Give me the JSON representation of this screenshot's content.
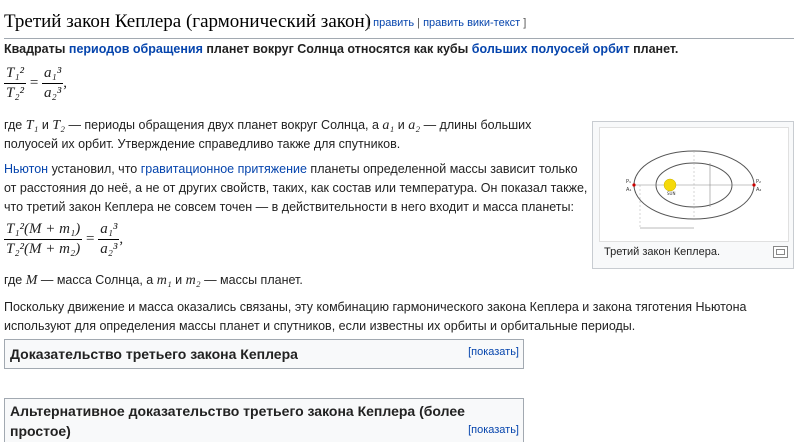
{
  "heading": {
    "title": "Третий закон Кеплера (гармонический закон)",
    "edit_open": "[ ",
    "edit_label": "править",
    "edit_sep": " | ",
    "edit_source_label": "править вики-текст",
    "edit_close": " ]"
  },
  "intro": {
    "t1": "Квадраты ",
    "link1": "периодов обращения",
    "t2": " планет вокруг Солнца относятся как кубы ",
    "link2": "больших полуосей орбит",
    "t3": " планет."
  },
  "formula1": {
    "num_left": "T₁²",
    "den_left": "T₂²",
    "eq": "=",
    "num_right": "a₁³",
    "den_right": "a₂³",
    "tail": ","
  },
  "para2": {
    "line1_a": "где ",
    "T1": "T₁",
    "line1_b": " и ",
    "T2": "T₂",
    "line1_c": " — периоды обращения двух планет вокруг Солнца, а ",
    "a1": "a₁",
    "line1_d": " и ",
    "a2": "a₂",
    "line1_e": " — длины больших",
    "line2": "полуосей их орбит. Утверждение справедливо также для спутников."
  },
  "para3": {
    "link_newton": "Ньютон",
    "line1_a": " установил, что ",
    "link_gravity": "гравитационное притяжение",
    "line1_b": " планеты определенной массы зависит только",
    "line2": "от расстояния до неё, а не от других свойств, таких, как состав или температура. Он показал также,",
    "line3": "что третий закон Кеплера не совсем точен — в действительности в него входит и масса планеты:"
  },
  "formula2": {
    "num_left": "T₁²(M + m₁)",
    "den_left": "T₂²(M + m₂)",
    "eq": "=",
    "num_right": "a₁³",
    "den_right": "a₂³",
    "tail": ","
  },
  "para4": {
    "a": "где ",
    "M": "M",
    "b": " — масса Солнца, а ",
    "m1": "m₁",
    "c": " и ",
    "m2": "m₂",
    "d": " — массы планет."
  },
  "para5": {
    "line1": "Поскольку движение и масса оказались связаны, эту комбинацию гармонического закона Кеплера и закона тяготения Ньютона",
    "line2": "используют для определения массы планет и спутников, если известны их орбиты и орбитальные периоды."
  },
  "thumb": {
    "caption": "Третий закон Кеплера.",
    "labels": {
      "p1": "P₁",
      "p2": "P₂",
      "a1": "A₁",
      "a2": "A₂",
      "sun": "SUN"
    }
  },
  "box1": {
    "title": "Доказательство третьего закона Кеплера",
    "toggle": "[показать]"
  },
  "box2": {
    "title_line1": "Альтернативное доказательство третьего закона Кеплера (более",
    "title_line2": "простое)",
    "toggle": "[показать]"
  },
  "colors": {
    "link": "#0645ad",
    "box_bg": "#f8f9fa",
    "border": "#a2a9b1",
    "sun": "#f5d90a"
  }
}
